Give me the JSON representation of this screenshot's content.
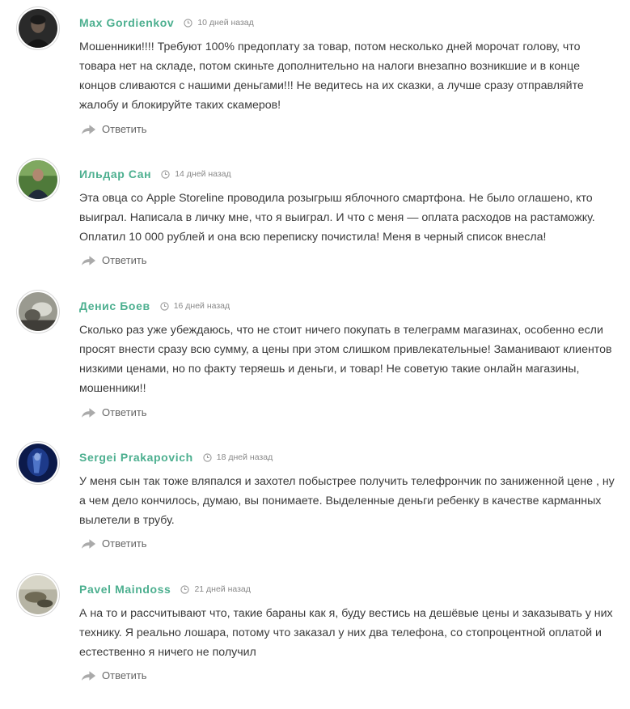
{
  "comments": [
    {
      "author": "Max Gordienkov",
      "date": "10 дней назад",
      "text": "Мошенники!!!! Требуют 100% предоплату за товар, потом несколько дней морочат голову, что товара нет на складе, потом скиньте дополнительно на налоги внезапно возникшие и в конце концов сливаются с нашими деньгами!!! Не ведитесь на их сказки, а лучше сразу отправляйте жалобу и блокируйте таких скамеров!",
      "reply_label": "Ответить"
    },
    {
      "author": "Ильдар Сан",
      "date": "14 дней назад",
      "text": "Эта овца со Apple Storeline проводила розыгрыш яблочного смартфона. Не было оглашено, кто выиграл. Написала в личку мне, что я выиграл. И что с меня — оплата расходов на растаможку. Оплатил 10 000 рублей и она всю переписку почистила! Меня в черный список внесла!",
      "reply_label": "Ответить"
    },
    {
      "author": "Денис Боев",
      "date": "16 дней назад",
      "text": "Сколько раз уже убеждаюсь, что не стоит ничего покупать в телеграмм магазинах, особенно если просят внести сразу всю сумму, а цены при этом слишком привлекательные! Заманивают клиентов низкими ценами, но по факту теряешь и деньги, и товар! Не советую такие онлайн магазины, мошенники!!",
      "reply_label": "Ответить"
    },
    {
      "author": "Sergei Prakapovich",
      "date": "18 дней назад",
      "text": "У меня сын так тоже вляпался и захотел побыстрее получить телефрончик по заниженной цене , ну а чем дело кончилось, думаю, вы понимаете. Выделенные деньги ребенку в качестве карманных вылетели в трубу.",
      "reply_label": "Ответить"
    },
    {
      "author": "Pavel Maindoss",
      "date": "21 дней назад",
      "text": "А на то и рассчитывают что, такие бараны как я, буду вестись на дешёвые цены и заказывать у них технику. Я реально лошара, потому что заказал у них два телефона, со стопроцентной оплатой и естественно я ничего не получил",
      "reply_label": "Ответить"
    }
  ],
  "colors": {
    "author": "#4caf8f",
    "text": "#3a3a3a",
    "meta": "#888888",
    "reply": "#666666"
  },
  "icons": {
    "date": "clock-icon",
    "reply": "reply-arrow-icon"
  }
}
